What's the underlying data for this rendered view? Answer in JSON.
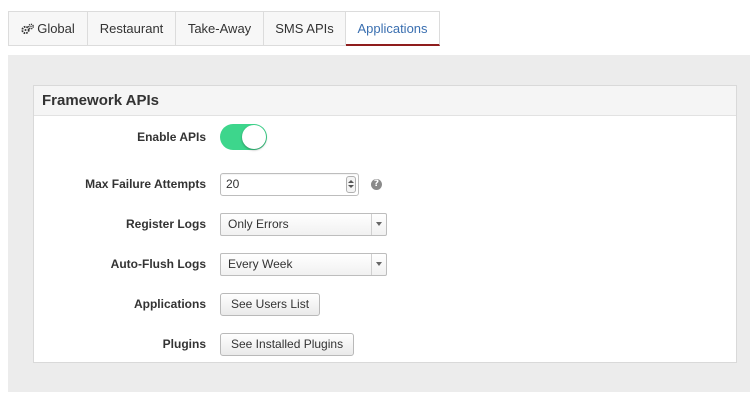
{
  "tabs": {
    "global": "Global",
    "restaurant": "Restaurant",
    "takeaway": "Take-Away",
    "sms": "SMS APIs",
    "applications": "Applications",
    "active": "Applications"
  },
  "panel": {
    "title": "Framework APIs"
  },
  "form": {
    "enable_apis": {
      "label": "Enable APIs",
      "value": true
    },
    "max_failure": {
      "label": "Max Failure Attempts",
      "value": "20",
      "help_icon": "question-circle-icon"
    },
    "register_logs": {
      "label": "Register Logs",
      "selected": "Only Errors"
    },
    "auto_flush": {
      "label": "Auto-Flush Logs",
      "selected": "Every Week"
    },
    "applications": {
      "label": "Applications",
      "button": "See Users List"
    },
    "plugins": {
      "label": "Plugins",
      "button": "See Installed Plugins"
    }
  },
  "colors": {
    "toggle_on": "#3dd68c",
    "active_tab_text": "#3a6fb0",
    "active_tab_underline": "#8f1d1d"
  }
}
